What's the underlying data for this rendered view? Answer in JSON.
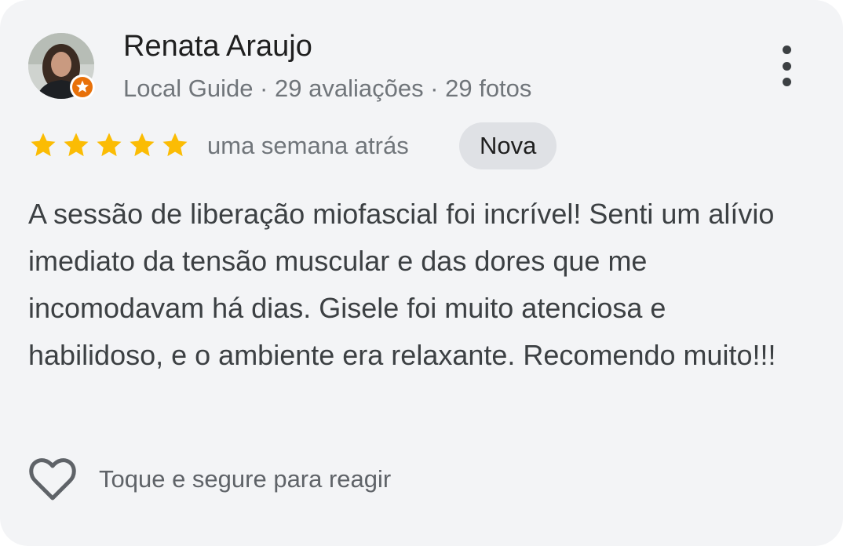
{
  "review": {
    "reviewer": {
      "name": "Renata Araujo",
      "meta": "Local Guide · 29 avaliações · 29 fotos",
      "badge_icon": "local-guide-star-badge",
      "badge_color": "#e8710a"
    },
    "rating": 5,
    "rating_max": 5,
    "star_color": "#fbbc04",
    "date": "uma semana atrás",
    "badge_label": "Nova",
    "text": "A sessão de liberação miofascial foi incrível! Senti um alívio imediato da tensão muscular e das dores que me incomodavam há dias. Gisele foi muito atenciosa e habilidoso, e o ambiente era relaxante. Recomendo muito!!!",
    "react_hint": "Toque e segure para reagir",
    "react_icon": "heart-outline-icon",
    "menu_icon": "more-vertical-icon"
  }
}
